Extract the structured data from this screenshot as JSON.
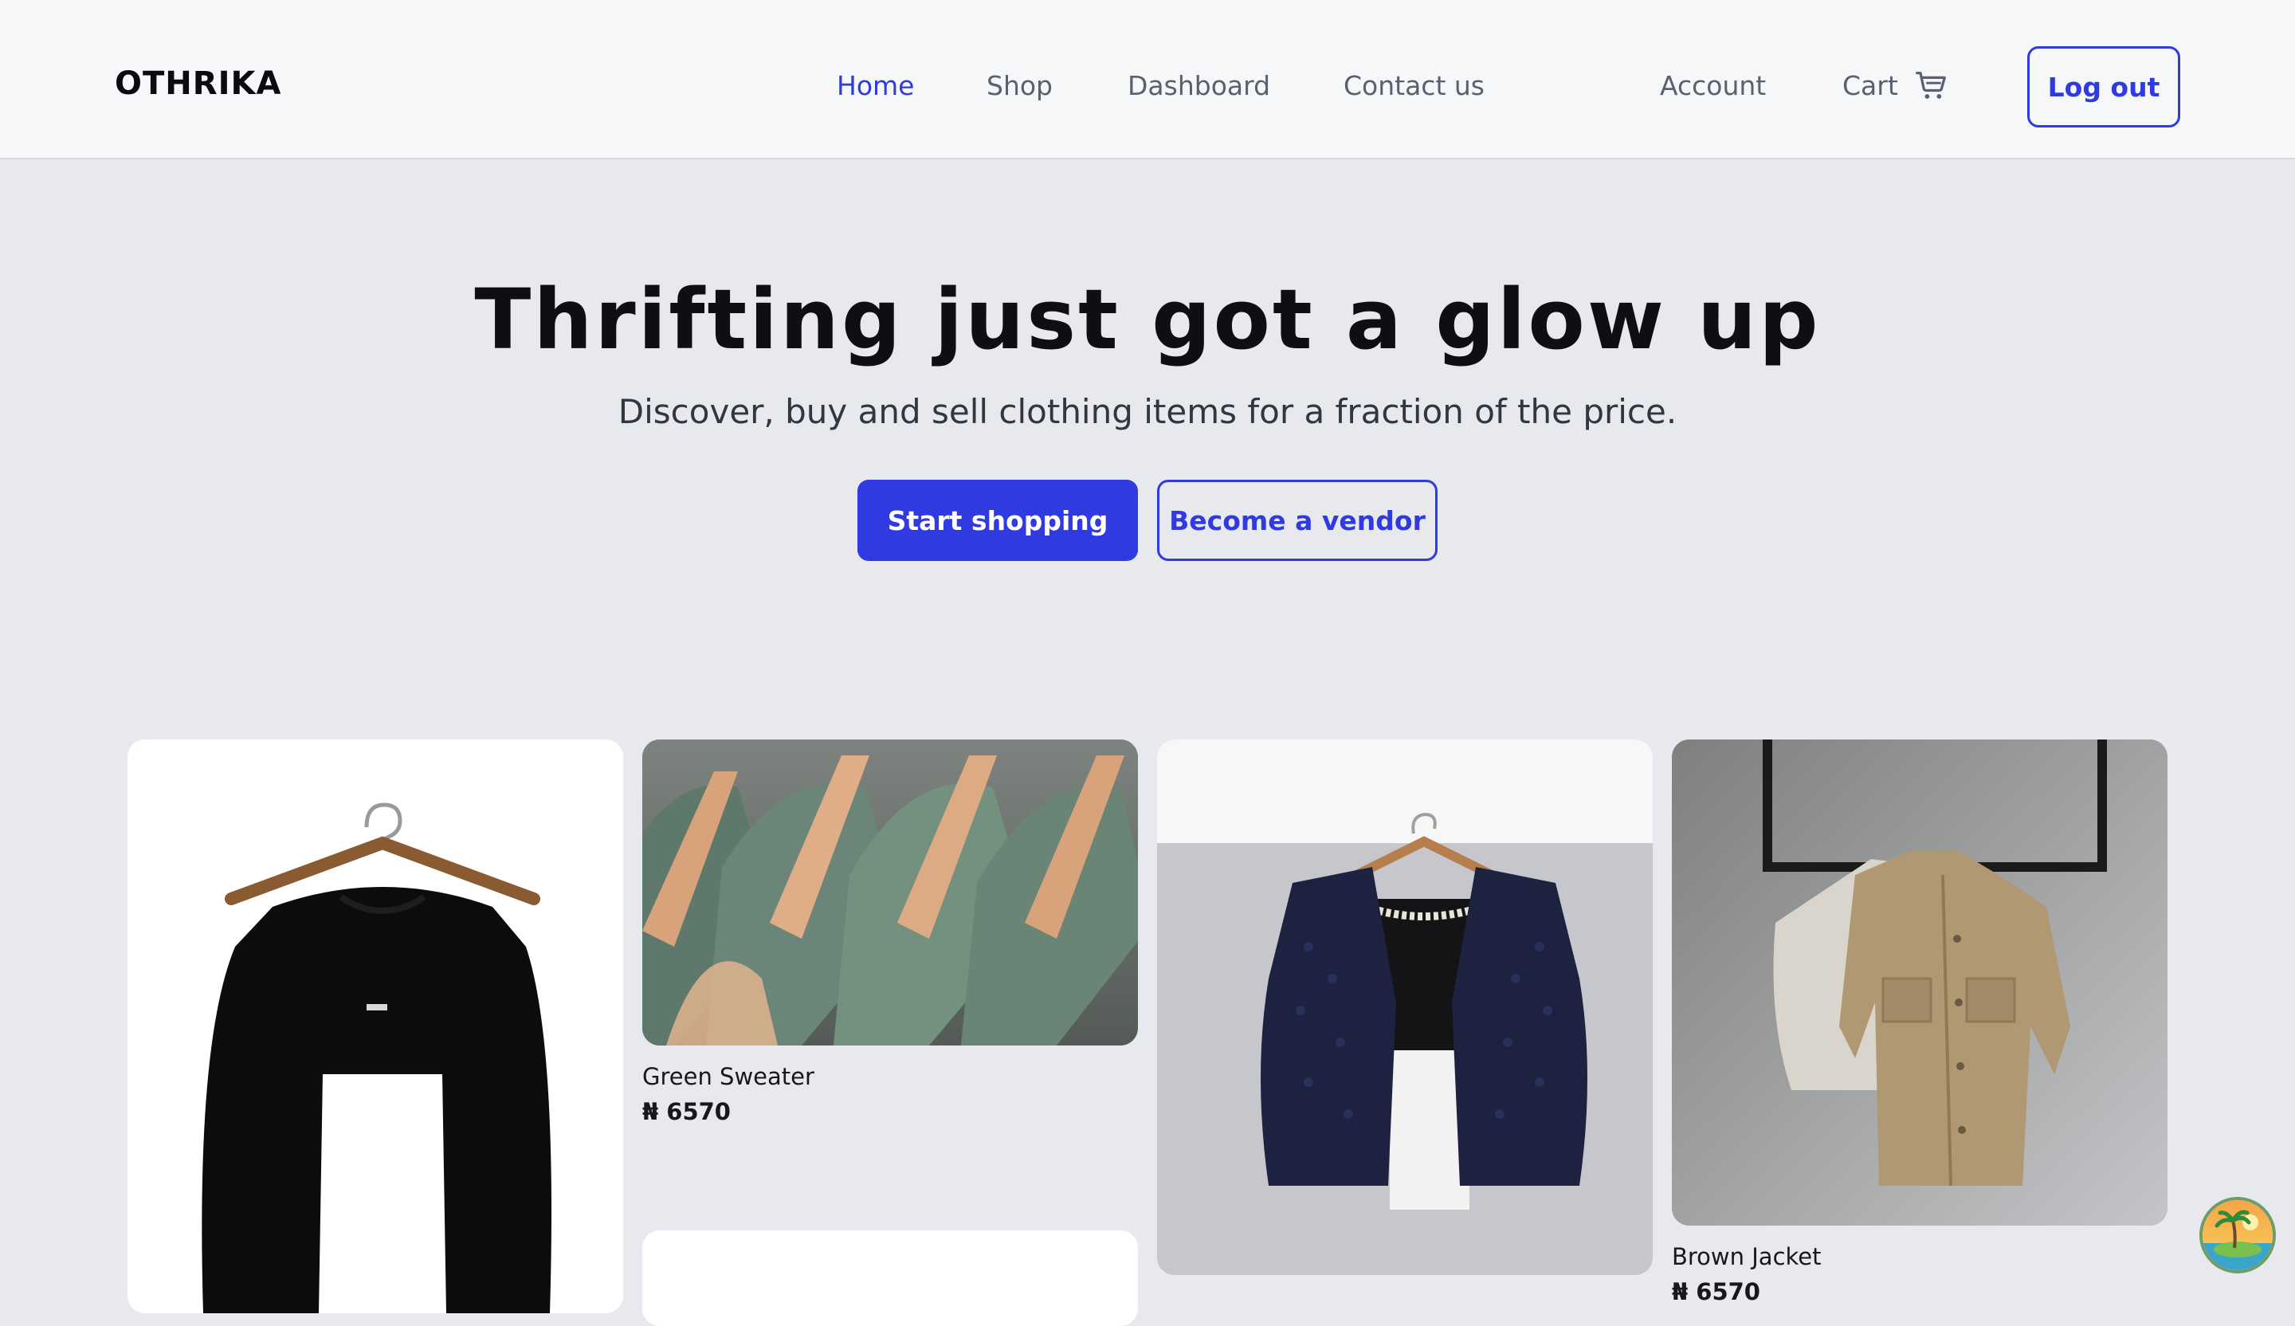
{
  "header": {
    "logo": "OTHRIKA",
    "nav": {
      "home": "Home",
      "shop": "Shop",
      "dashboard": "Dashboard",
      "contact": "Contact us",
      "account": "Account",
      "cart": "Cart"
    },
    "logout_label": "Log out",
    "active_color": "#2f3ae0"
  },
  "hero": {
    "title": "Thrifting just got a glow up",
    "subtitle": "Discover, buy and sell clothing items for a fraction of the price.",
    "primary_cta": "Start shopping",
    "secondary_cta": "Become a vendor"
  },
  "products": [
    {
      "name": "",
      "price": "",
      "image": "black-longsleeve-shirt"
    },
    {
      "name": "Green Sweater",
      "price": "₦ 6570",
      "image": "green-sweaters-on-hangers"
    },
    {
      "name": "",
      "price": "",
      "image": "navy-knit-vest"
    },
    {
      "name": "Brown Jacket",
      "price": "₦ 6570",
      "image": "brown-jacket-on-rail"
    }
  ],
  "icons": {
    "cart": "cart-icon",
    "assistant": "island-avatar-icon"
  }
}
